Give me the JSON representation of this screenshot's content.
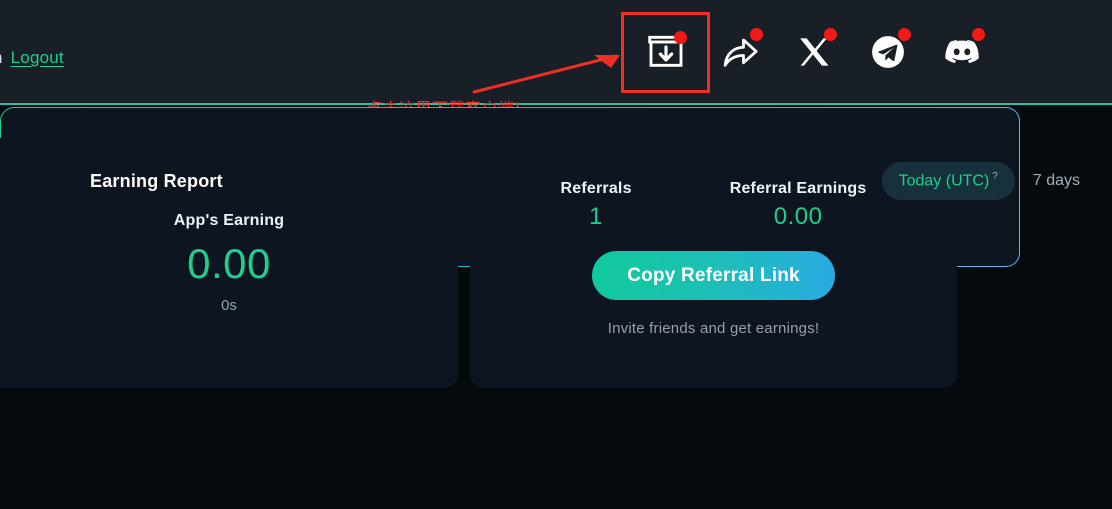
{
  "header": {
    "partial_text": "n",
    "logout_label": "Logout",
    "icons": [
      {
        "name": "download-client-icon",
        "label": "download"
      },
      {
        "name": "share-icon",
        "label": "share"
      },
      {
        "name": "x-twitter-icon",
        "label": "X"
      },
      {
        "name": "telegram-icon",
        "label": "Telegram"
      },
      {
        "name": "discord-icon",
        "label": "Discord"
      }
    ]
  },
  "annotation": {
    "text": "点击这里下载客户端!",
    "color": "#ee2f24"
  },
  "app_earning": {
    "title": "App's Earning",
    "value": "0.00",
    "duration": "0s"
  },
  "referral": {
    "referrals_label": "Referrals",
    "referrals_value": "1",
    "earnings_label": "Referral Earnings",
    "earnings_value": "0.00",
    "copy_button": "Copy Referral Link",
    "invite_text": "Invite friends and get earnings!"
  },
  "report": {
    "title": "Earning Report",
    "tab_today": "Today (UTC)",
    "tab_today_hint": "?",
    "tab_7days": "7 days"
  },
  "colors": {
    "accent_green": "#1fcd8d",
    "accent_blue": "#29abe2",
    "alert_red": "#ee2f24",
    "card_bg": "#0d1620",
    "page_bg": "#040a0e",
    "header_bg": "#191f27"
  }
}
